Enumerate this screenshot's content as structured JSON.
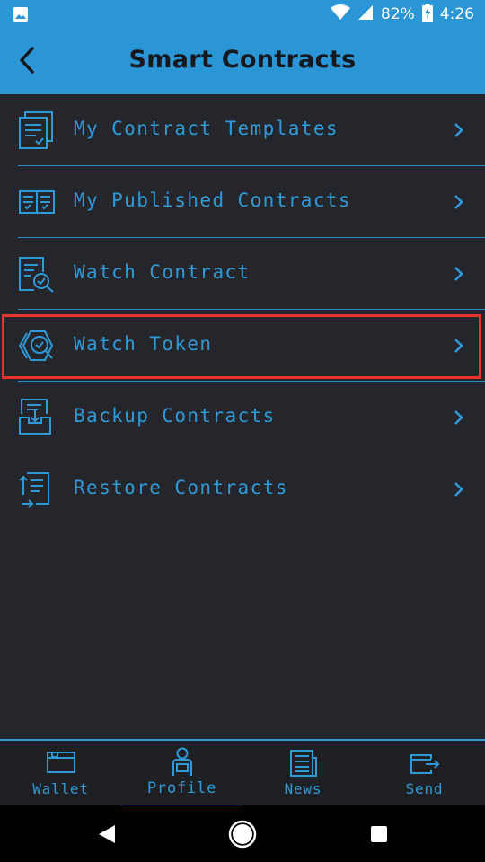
{
  "status_bar": {
    "battery_percent": "82%",
    "time": "4:26",
    "icons": [
      "image-notification-icon",
      "wifi-icon",
      "cell-signal-icon",
      "battery-charging-icon"
    ]
  },
  "app_bar": {
    "title": "Smart Contracts",
    "back_icon": "back-arrow-icon"
  },
  "menu": {
    "items": [
      {
        "label": "My Contract Templates",
        "icon": "contract-templates-icon"
      },
      {
        "label": "My Published Contracts",
        "icon": "published-contracts-icon"
      },
      {
        "label": "Watch Contract",
        "icon": "watch-contract-icon"
      },
      {
        "label": "Watch Token",
        "icon": "watch-token-icon",
        "highlighted": true
      },
      {
        "label": "Backup Contracts",
        "icon": "backup-contracts-icon"
      },
      {
        "label": "Restore Contracts",
        "icon": "restore-contracts-icon"
      }
    ],
    "chevron_icon": "chevron-right-icon"
  },
  "tabs": [
    {
      "label": "Wallet",
      "icon": "wallet-icon"
    },
    {
      "label": "Profile",
      "icon": "profile-icon",
      "active": true
    },
    {
      "label": "News",
      "icon": "news-icon"
    },
    {
      "label": "Send",
      "icon": "send-icon"
    }
  ],
  "colors": {
    "accent": "#2f9ad8",
    "header_bg": "#2b96d6",
    "background": "#25262b",
    "highlight": "#e8332e"
  }
}
